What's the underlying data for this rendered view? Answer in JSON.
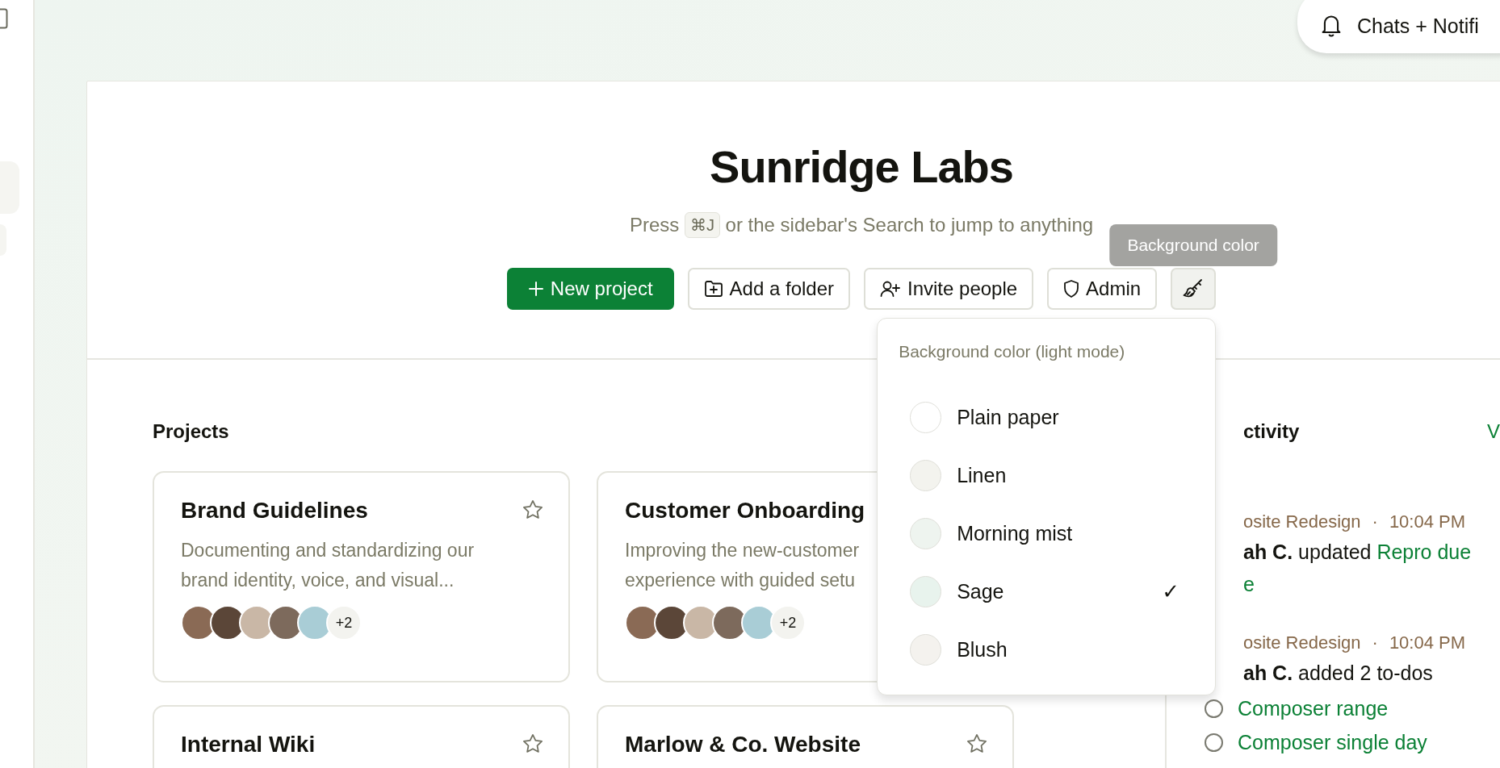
{
  "notifications_button": {
    "label": "Chats + Notifi"
  },
  "header": {
    "title": "Sunridge Labs",
    "subtitle_before": "Press",
    "shortcut": "⌘J",
    "subtitle_after": "or the sidebar's Search to jump to anything"
  },
  "actions": [
    {
      "kind": "primary",
      "label": "New project"
    },
    {
      "kind": "folder",
      "label": "Add a folder"
    },
    {
      "kind": "invite",
      "label": "Invite people"
    },
    {
      "kind": "admin",
      "label": "Admin"
    },
    {
      "kind": "brush"
    }
  ],
  "tooltip": "Background color",
  "color_menu": {
    "title": "Background color (light mode)",
    "options": [
      {
        "label": "Plain paper",
        "color": "#ffffff",
        "selected": false
      },
      {
        "label": "Linen",
        "color": "#f3f3ee",
        "selected": false
      },
      {
        "label": "Morning mist",
        "color": "#eef4ef",
        "selected": false
      },
      {
        "label": "Sage",
        "color": "#e8f3ed",
        "selected": true
      },
      {
        "label": "Blush",
        "color": "#f4f2ee",
        "selected": false
      }
    ],
    "check": "✓"
  },
  "projects": {
    "title": "Projects",
    "cards": [
      {
        "title": "Brand Guidelines",
        "starred": false,
        "description_lines": [
          "Documenting and standardizing our",
          "brand identity, voice, and visual..."
        ],
        "members_extra": "+2"
      },
      {
        "title": "Customer Onboarding",
        "description_lines": [
          "Improving the new-customer",
          "experience with guided setu"
        ],
        "members_extra": "+2"
      },
      {
        "title": "Internal Wiki",
        "starred": false
      },
      {
        "title": "Marlow & Co. Website",
        "starred": false
      }
    ]
  },
  "activity": {
    "title": "ctivity",
    "view_all": "V",
    "entries": [
      {
        "project": "osite Redesign",
        "separator": "·",
        "time": "10:04 PM",
        "text": "**ah C.** updated",
        "link": "Repro due",
        "link_continued": "e"
      },
      {
        "project": "osite Redesign",
        "separator": "·",
        "time": "10:04 PM",
        "text": "**ah C.** added 2 to-dos",
        "todos": [
          {
            "label": "Composer range",
            "done": false
          },
          {
            "label": "Composer single day",
            "done": false
          }
        ]
      }
    ]
  }
}
